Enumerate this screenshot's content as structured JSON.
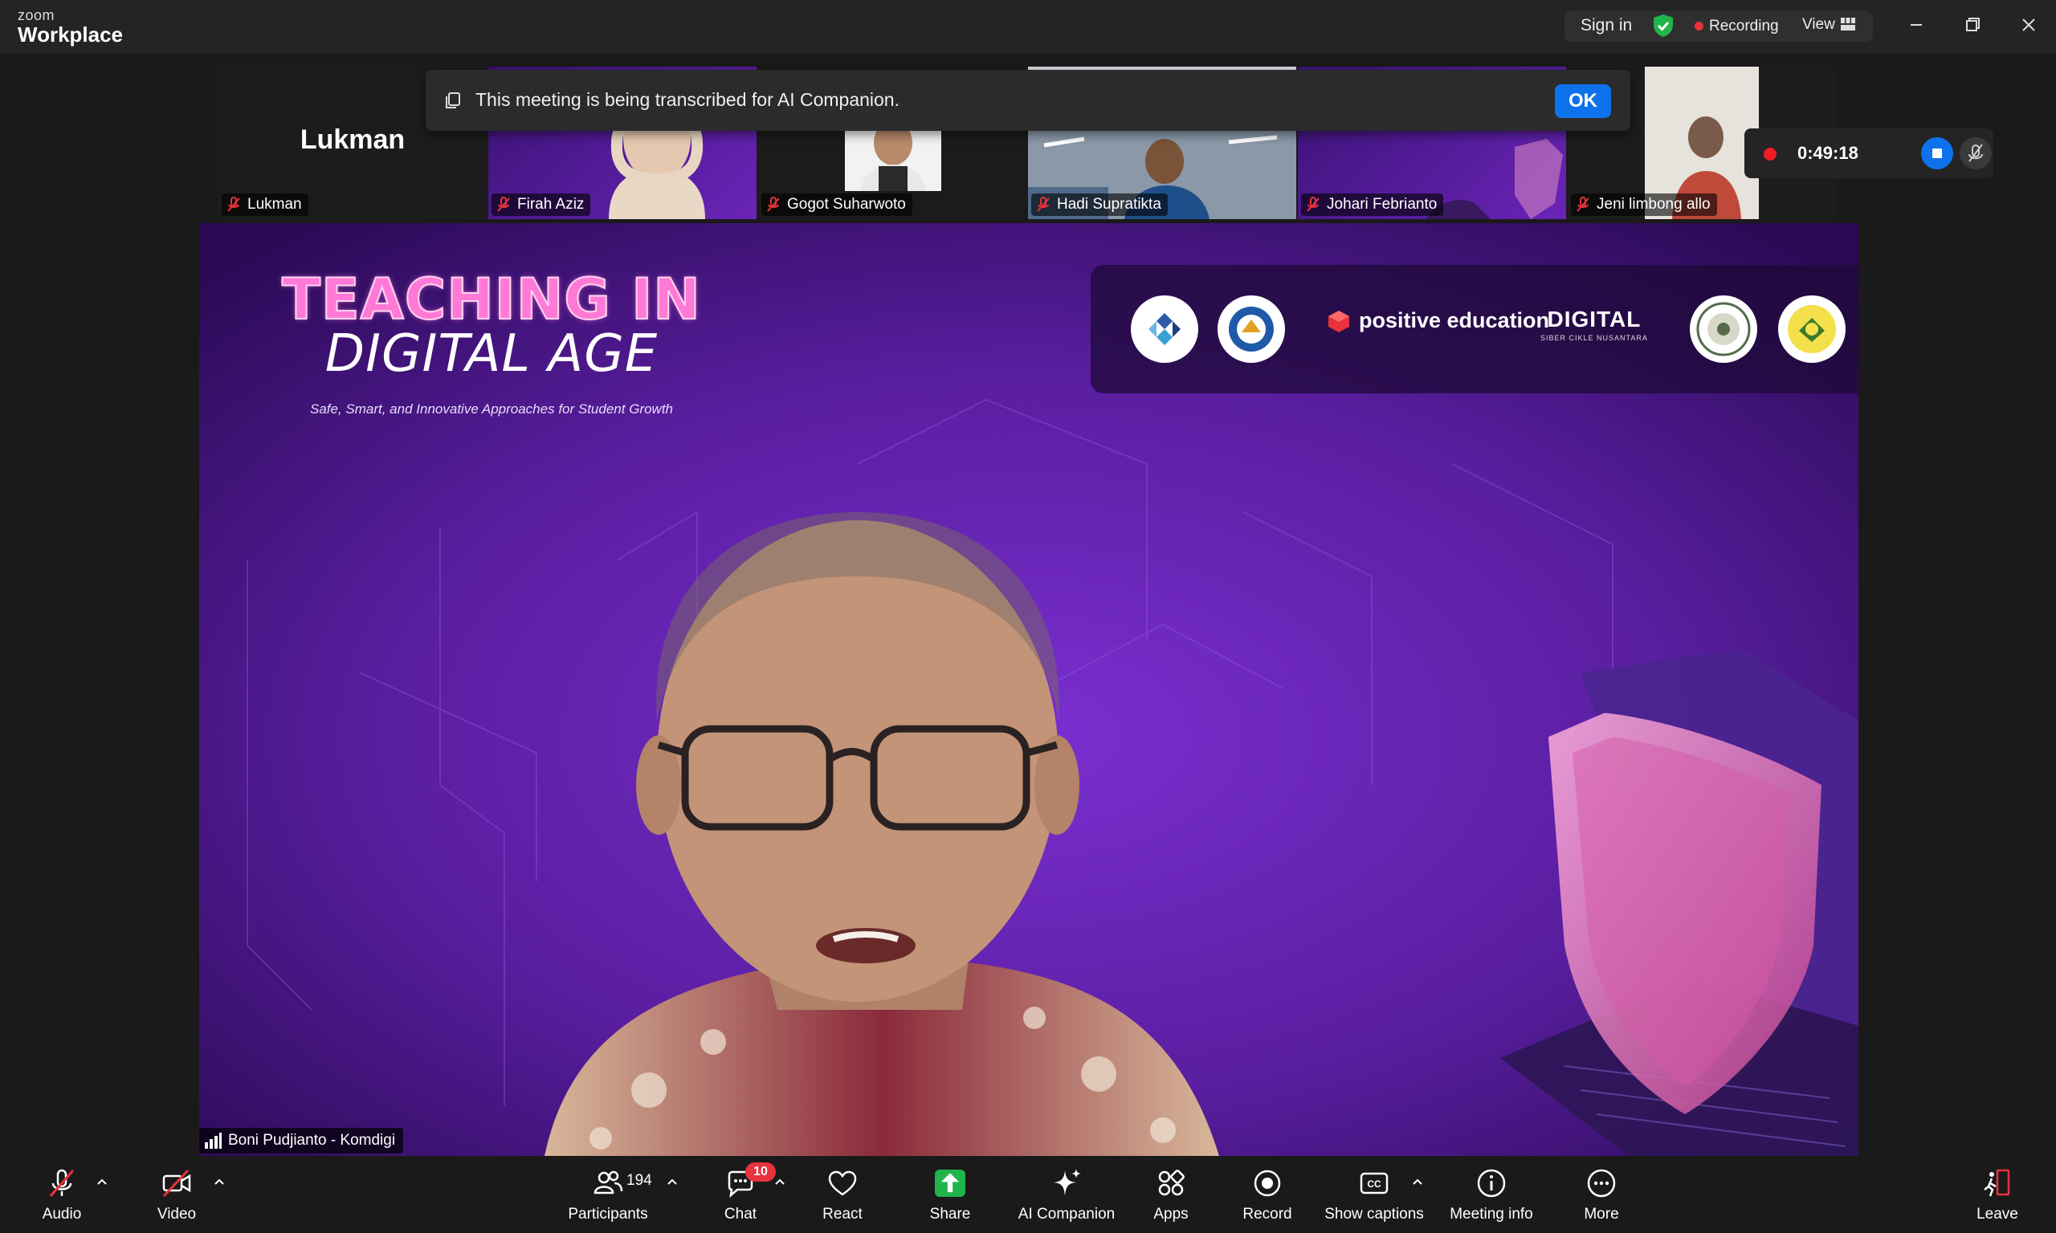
{
  "app": {
    "brand_small": "zoom",
    "brand_big": "Workplace"
  },
  "titlebar": {
    "sign_in": "Sign in",
    "recording": "Recording",
    "view": "View"
  },
  "notification": {
    "message": "This meeting is being transcribed for AI Companion.",
    "ok": "OK"
  },
  "recording_widget": {
    "elapsed": "0:49:18"
  },
  "participants_strip": [
    {
      "name": "Lukman",
      "display_text": "Lukman"
    },
    {
      "name": "Firah Aziz"
    },
    {
      "name": "Gogot Suharwoto"
    },
    {
      "name": "Hadi Supratikta"
    },
    {
      "name": "Johari Febrianto"
    },
    {
      "name": "Jeni limbong allo"
    }
  ],
  "main_video": {
    "speaker": "Boni Pudjianto - Komdigi",
    "slide_title_line1": "TEACHING IN",
    "slide_title_line2": "DIGITAL AGE",
    "slide_subtitle": "Safe, Smart, and Innovative Approaches for Student Growth",
    "logo_positive": "positive education",
    "logo_digital": "DIGITAL",
    "logo_digital_sub": "SIBER CIKLE NUSANTARA"
  },
  "toolbar": {
    "audio": "Audio",
    "video": "Video",
    "participants": "Participants",
    "participants_count": "194",
    "chat": "Chat",
    "chat_badge": "10",
    "react": "React",
    "share": "Share",
    "ai_companion": "AI Companion",
    "apps": "Apps",
    "record": "Record",
    "show_captions": "Show captions",
    "meeting_info": "Meeting info",
    "more": "More",
    "leave": "Leave"
  },
  "colors": {
    "accent_blue": "#0e72ed",
    "share_green": "#20b44b",
    "record_red": "#e8323c",
    "slide_purple": "#5a1ea0"
  }
}
